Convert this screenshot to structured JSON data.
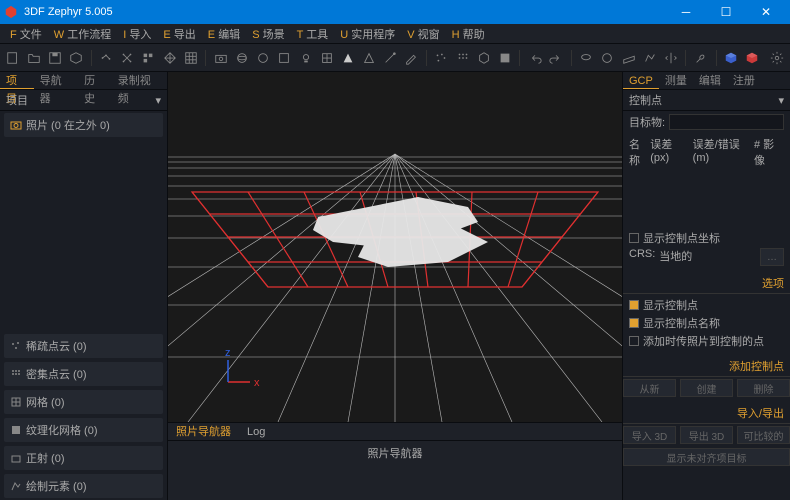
{
  "window": {
    "title": "3DF Zephyr 5.005"
  },
  "menu": {
    "file": {
      "accel": "F",
      "label": "文件"
    },
    "workflow": {
      "accel": "W",
      "label": "工作流程"
    },
    "import": {
      "accel": "I",
      "label": "导入"
    },
    "export": {
      "accel": "E",
      "label": "导出"
    },
    "edit": {
      "accel": "E",
      "label": "编辑"
    },
    "scene": {
      "accel": "S",
      "label": "场景"
    },
    "tools": {
      "accel": "T",
      "label": "工具"
    },
    "utilities": {
      "accel": "U",
      "label": "实用程序"
    },
    "view": {
      "accel": "V",
      "label": "视窗"
    },
    "help": {
      "accel": "H",
      "label": "帮助"
    }
  },
  "left": {
    "tabs": {
      "project": "项目",
      "navigator": "导航器",
      "history": "历史",
      "record": "录制视频"
    },
    "sub": "项目",
    "photos": "照片 (0 在之外 0)",
    "items": {
      "sparse": "稀疏点云 (0)",
      "dense": "密集点云 (0)",
      "mesh": "网格 (0)",
      "textured": "纹理化网格 (0)",
      "ortho": "正射 (0)",
      "elements": "绘制元素 (0)"
    },
    "bottom_tabs": {
      "nav": "照片导航器",
      "log": "Log"
    },
    "bottom_title": "照片导航器"
  },
  "right": {
    "tabs": {
      "gcp": "GCP",
      "measure": "测量",
      "edit": "编辑",
      "register": "注册"
    },
    "controlpoints": "控制点",
    "target": "目标物:",
    "headers": {
      "name": "名称",
      "err": "误差 (px)",
      "dist": "误差/错误(m)",
      "img": "# 影像"
    },
    "show_coords": "显示控制点坐标",
    "crs_label": "CRS:",
    "crs_value": "当地的",
    "options": "选项",
    "opt1": "显示控制点",
    "opt2": "显示控制点名称",
    "opt3": "添加时传照片到控制的点",
    "add_cp": "添加控制点",
    "btns1": {
      "a": "从新",
      "b": "创建",
      "c": "删除"
    },
    "io": "导入/导出",
    "btns2": {
      "a": "导入 3D",
      "b": "导出 3D",
      "c": "可比较的"
    },
    "last": "显示未对齐项目标"
  },
  "viewport": {
    "axes": {
      "x": "x",
      "z": "z"
    }
  }
}
